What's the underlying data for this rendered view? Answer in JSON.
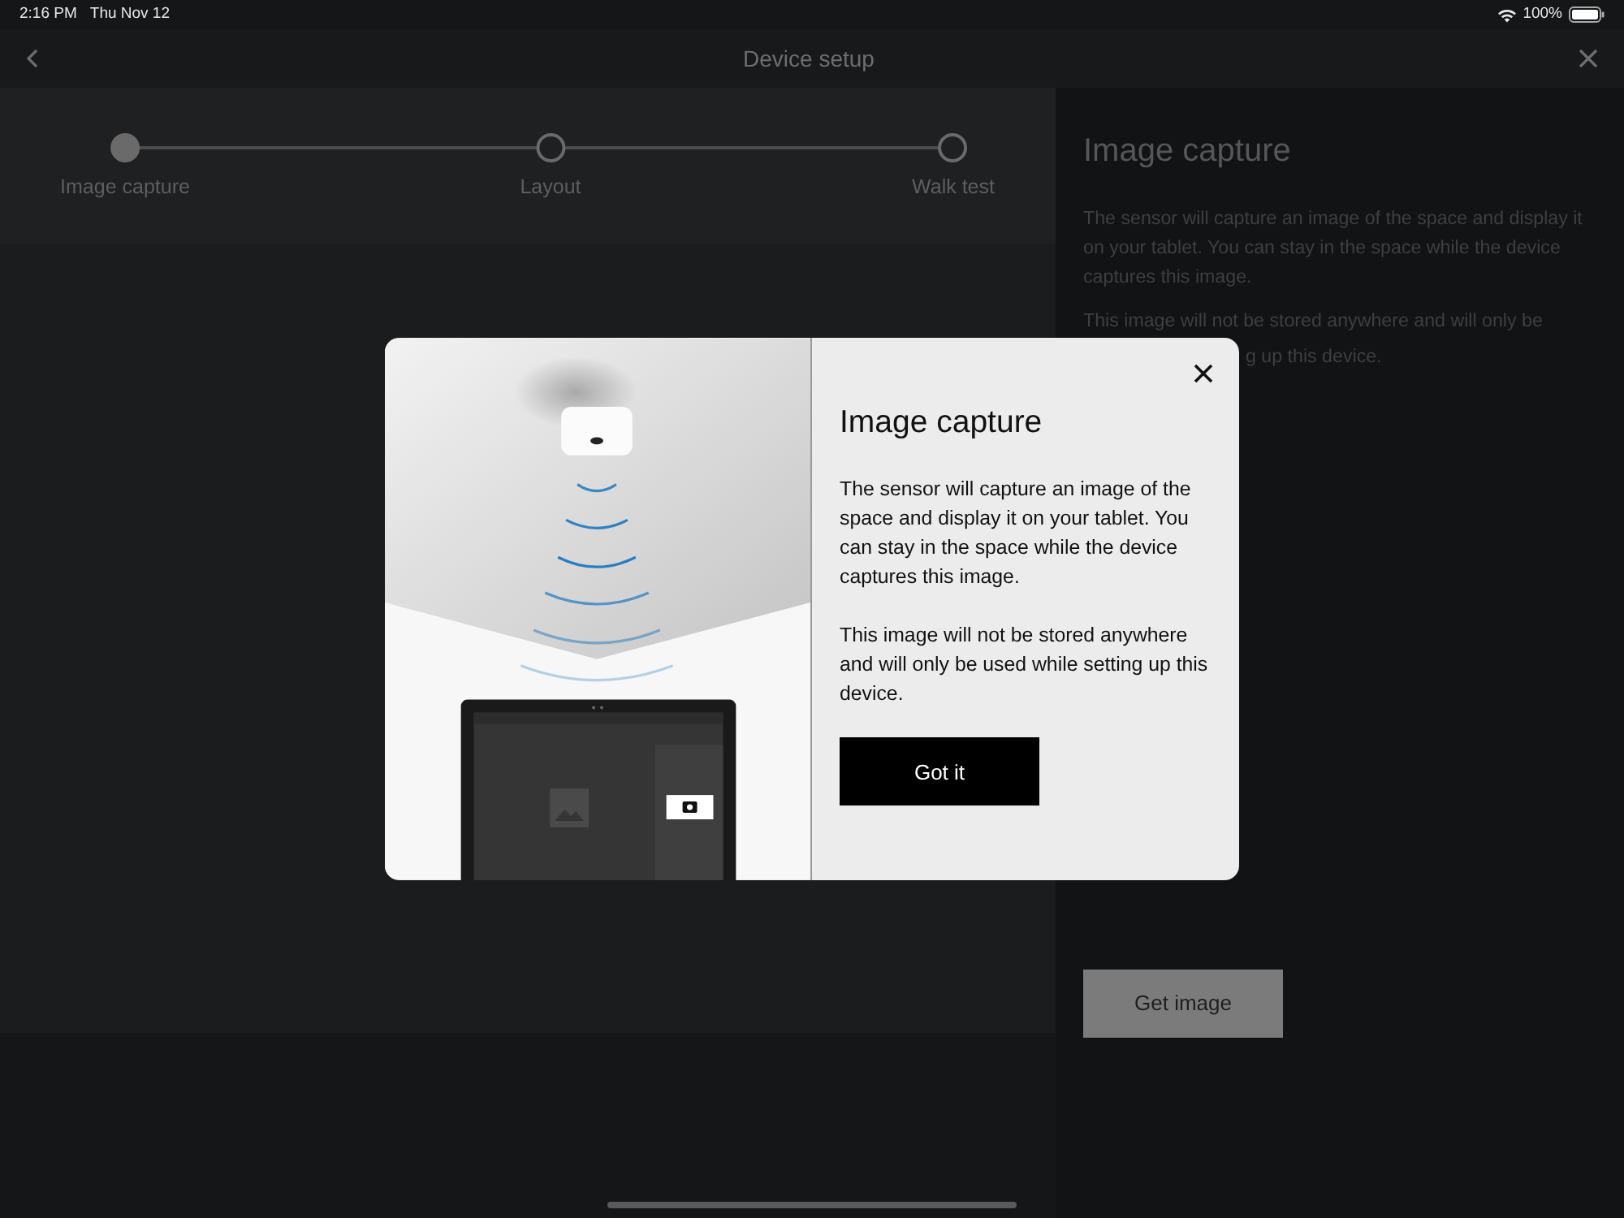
{
  "status_bar": {
    "time": "2:16 PM",
    "date": "Thu Nov 12",
    "battery": "100%"
  },
  "header": {
    "title": "Device setup"
  },
  "stepper": [
    {
      "label": "Image capture",
      "selected": true
    },
    {
      "label": "Layout",
      "selected": false
    },
    {
      "label": "Walk test",
      "selected": false
    }
  ],
  "side_panel": {
    "title": "Image capture",
    "paragraph": "The sensor will capture an image of the space and display it on your tablet. You can stay in the space while the device captures this image.",
    "second_paragraph_visible": [
      "This image will not be stored anywhere and will only be",
      "g up this device."
    ],
    "button": "Get image"
  },
  "dialog": {
    "title": "Image capture",
    "paragraphs": [
      "The sensor will capture an image of the space and display it on your tablet. You can stay in the space while the device captures this image.",
      "This image will not be stored anywhere and will only be used while setting up this device."
    ],
    "button": "Got it"
  }
}
